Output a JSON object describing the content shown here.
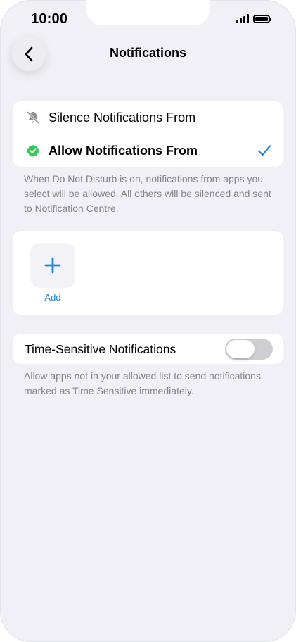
{
  "status_bar": {
    "time": "10:00",
    "signal_icon": "cellular-signal-icon",
    "battery_icon": "battery-icon"
  },
  "nav": {
    "back_icon": "chevron-left-icon",
    "title": "Notifications"
  },
  "options": {
    "items": [
      {
        "label": "Silence Notifications From",
        "icon": "bell-slash-icon",
        "selected": false
      },
      {
        "label": "Allow Notifications From",
        "icon": "checkmark-seal-icon",
        "selected": true
      }
    ],
    "selected_check_icon": "checkmark-icon",
    "footnote": "When Do Not Disturb is on, notifications from apps you select will be allowed. All others will be silenced and sent to Notification Centre."
  },
  "apps": {
    "add_icon": "plus-icon",
    "add_label": "Add"
  },
  "time_sensitive": {
    "label": "Time-Sensitive Notifications",
    "enabled": false,
    "footnote": "Allow apps not in your allowed list to send notifications marked as Time Sensitive immediately."
  },
  "colors": {
    "accent": "#1e84d6",
    "check_green": "#34c759",
    "background": "#f0f0f6",
    "toggle_off": "#cfcfd3"
  }
}
